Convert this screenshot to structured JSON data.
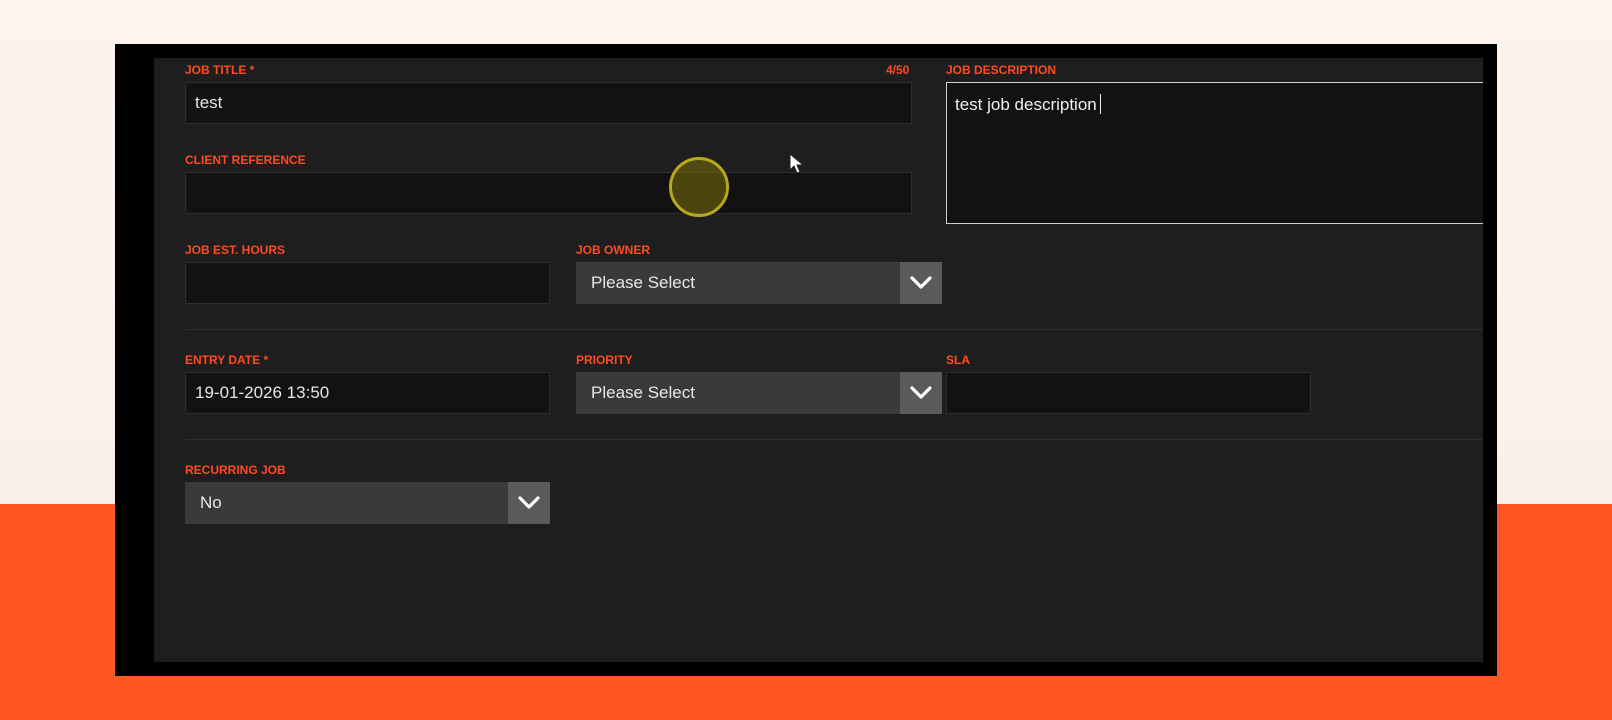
{
  "form": {
    "job_title": {
      "label": "JOB TITLE *",
      "value": "test",
      "counter": "4/50"
    },
    "job_description": {
      "label": "JOB DESCRIPTION",
      "value": "test job description"
    },
    "client_reference": {
      "label": "CLIENT REFERENCE",
      "value": ""
    },
    "job_est_hours": {
      "label": "JOB EST. HOURS",
      "value": ""
    },
    "job_owner": {
      "label": "JOB OWNER",
      "selected": "Please Select"
    },
    "entry_date": {
      "label": "ENTRY DATE *",
      "value": "19-01-2026 13:50"
    },
    "priority": {
      "label": "PRIORITY",
      "selected": "Please Select"
    },
    "sla": {
      "label": "SLA",
      "value": ""
    },
    "recurring_job": {
      "label": "RECURRING JOB",
      "selected": "No"
    }
  },
  "colors": {
    "label_accent": "#ff4b1f",
    "page_orange": "#ff5722",
    "panel_bg": "#1e1e1e",
    "click_highlight": "#b8a81c"
  },
  "icons": {
    "dropdown": "chevron-down-icon",
    "mouse": "mouse-pointer-icon",
    "click": "click-highlight-icon"
  }
}
